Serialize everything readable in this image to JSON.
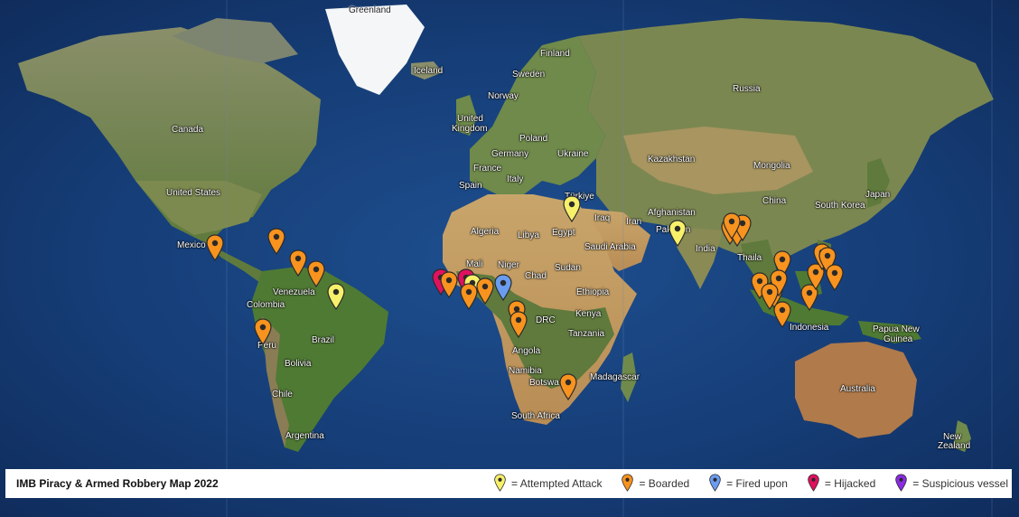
{
  "legend": {
    "title": "IMB Piracy & Armed Robbery Map 2022",
    "items": [
      {
        "label": "= Attempted Attack",
        "color": "#f7f06a",
        "icon": "yellow-pin-icon"
      },
      {
        "label": "= Boarded",
        "color": "#f7931e",
        "icon": "orange-pin-icon"
      },
      {
        "label": "= Fired upon",
        "color": "#6a9cf0",
        "icon": "blue-pin-icon"
      },
      {
        "label": "= Hijacked",
        "color": "#e0115f",
        "icon": "red-pin-icon"
      },
      {
        "label": "= Suspicious vessel",
        "color": "#8a2be2",
        "icon": "purple-pin-icon"
      }
    ]
  },
  "places": {
    "greenland": "Greenland",
    "iceland": "Iceland",
    "finland": "Finland",
    "sweden": "Sweden",
    "norway": "Norway",
    "uk1": "United",
    "uk2": "Kingdom",
    "poland": "Poland",
    "germany": "Germany",
    "ukraine": "Ukraine",
    "france": "France",
    "spain": "Spain",
    "italy": "Italy",
    "turkiye": "Türkiye",
    "russia": "Russia",
    "kazakhstan": "Kazakhstan",
    "mongolia": "Mongolia",
    "china": "China",
    "japan": "Japan",
    "south_korea": "South Korea",
    "afghanistan": "Afghanistan",
    "pakistan": "Pakistan",
    "india": "India",
    "thailand": "Thaila",
    "iraq": "Iraq",
    "iran": "Iran",
    "saudi": "Saudi Arabia",
    "egypt": "Egypt",
    "algeria": "Algeria",
    "libya": "Libya",
    "mali": "Mali",
    "niger": "Niger",
    "chad": "Chad",
    "sudan": "Sudan",
    "ethiopia": "Ethiopia",
    "kenya": "Kenya",
    "drc": "DRC",
    "tanzania": "Tanzania",
    "angola": "Angola",
    "namibia": "Namibia",
    "botswana": "Botswa",
    "madagascar": "Madagascar",
    "south_africa": "South Africa",
    "canada": "Canada",
    "united_states": "United States",
    "mexico": "Mexico",
    "venezuela": "Venezuela",
    "colombia": "Colombia",
    "peru": "Peru",
    "brazil": "Brazil",
    "bolivia": "Bolivia",
    "chile": "Chile",
    "argentina": "Argentina",
    "indonesia": "Indonesia",
    "png1": "Papua New",
    "png2": "Guinea",
    "australia": "Australia",
    "nz1": "New",
    "nz2": "Zealand"
  },
  "incidents": [
    {
      "type": "Boarded",
      "color": "#f7931e"
    },
    {
      "type": "Boarded",
      "color": "#f7931e"
    },
    {
      "type": "Boarded",
      "color": "#f7931e"
    },
    {
      "type": "Boarded",
      "color": "#f7931e"
    },
    {
      "type": "Attempted Attack",
      "color": "#f7f06a"
    },
    {
      "type": "Boarded",
      "color": "#f7931e"
    },
    {
      "type": "Attempted Attack",
      "color": "#f7f06a"
    },
    {
      "type": "Hijacked",
      "color": "#e0115f"
    },
    {
      "type": "Boarded",
      "color": "#f7931e"
    },
    {
      "type": "Hijacked",
      "color": "#e0115f"
    },
    {
      "type": "Attempted Attack",
      "color": "#f7f06a"
    },
    {
      "type": "Boarded",
      "color": "#f7931e"
    },
    {
      "type": "Boarded",
      "color": "#f7931e"
    },
    {
      "type": "Fired upon",
      "color": "#6a9cf0"
    },
    {
      "type": "Boarded",
      "color": "#f7931e"
    },
    {
      "type": "Boarded",
      "color": "#f7931e"
    },
    {
      "type": "Boarded",
      "color": "#f7931e"
    },
    {
      "type": "Attempted Attack",
      "color": "#f7f06a"
    },
    {
      "type": "Boarded",
      "color": "#f7931e"
    },
    {
      "type": "Boarded",
      "color": "#f7931e"
    },
    {
      "type": "Boarded",
      "color": "#f7931e"
    },
    {
      "type": "Boarded",
      "color": "#f7931e"
    },
    {
      "type": "Boarded",
      "color": "#f7931e"
    },
    {
      "type": "Boarded",
      "color": "#f7931e"
    },
    {
      "type": "Boarded",
      "color": "#f7931e"
    },
    {
      "type": "Boarded",
      "color": "#f7931e"
    },
    {
      "type": "Boarded",
      "color": "#f7931e"
    },
    {
      "type": "Boarded",
      "color": "#f7931e"
    },
    {
      "type": "Boarded",
      "color": "#f7931e"
    },
    {
      "type": "Boarded",
      "color": "#f7931e"
    },
    {
      "type": "Boarded",
      "color": "#f7931e"
    },
    {
      "type": "Boarded",
      "color": "#f7931e"
    },
    {
      "type": "Boarded",
      "color": "#f7931e"
    }
  ]
}
